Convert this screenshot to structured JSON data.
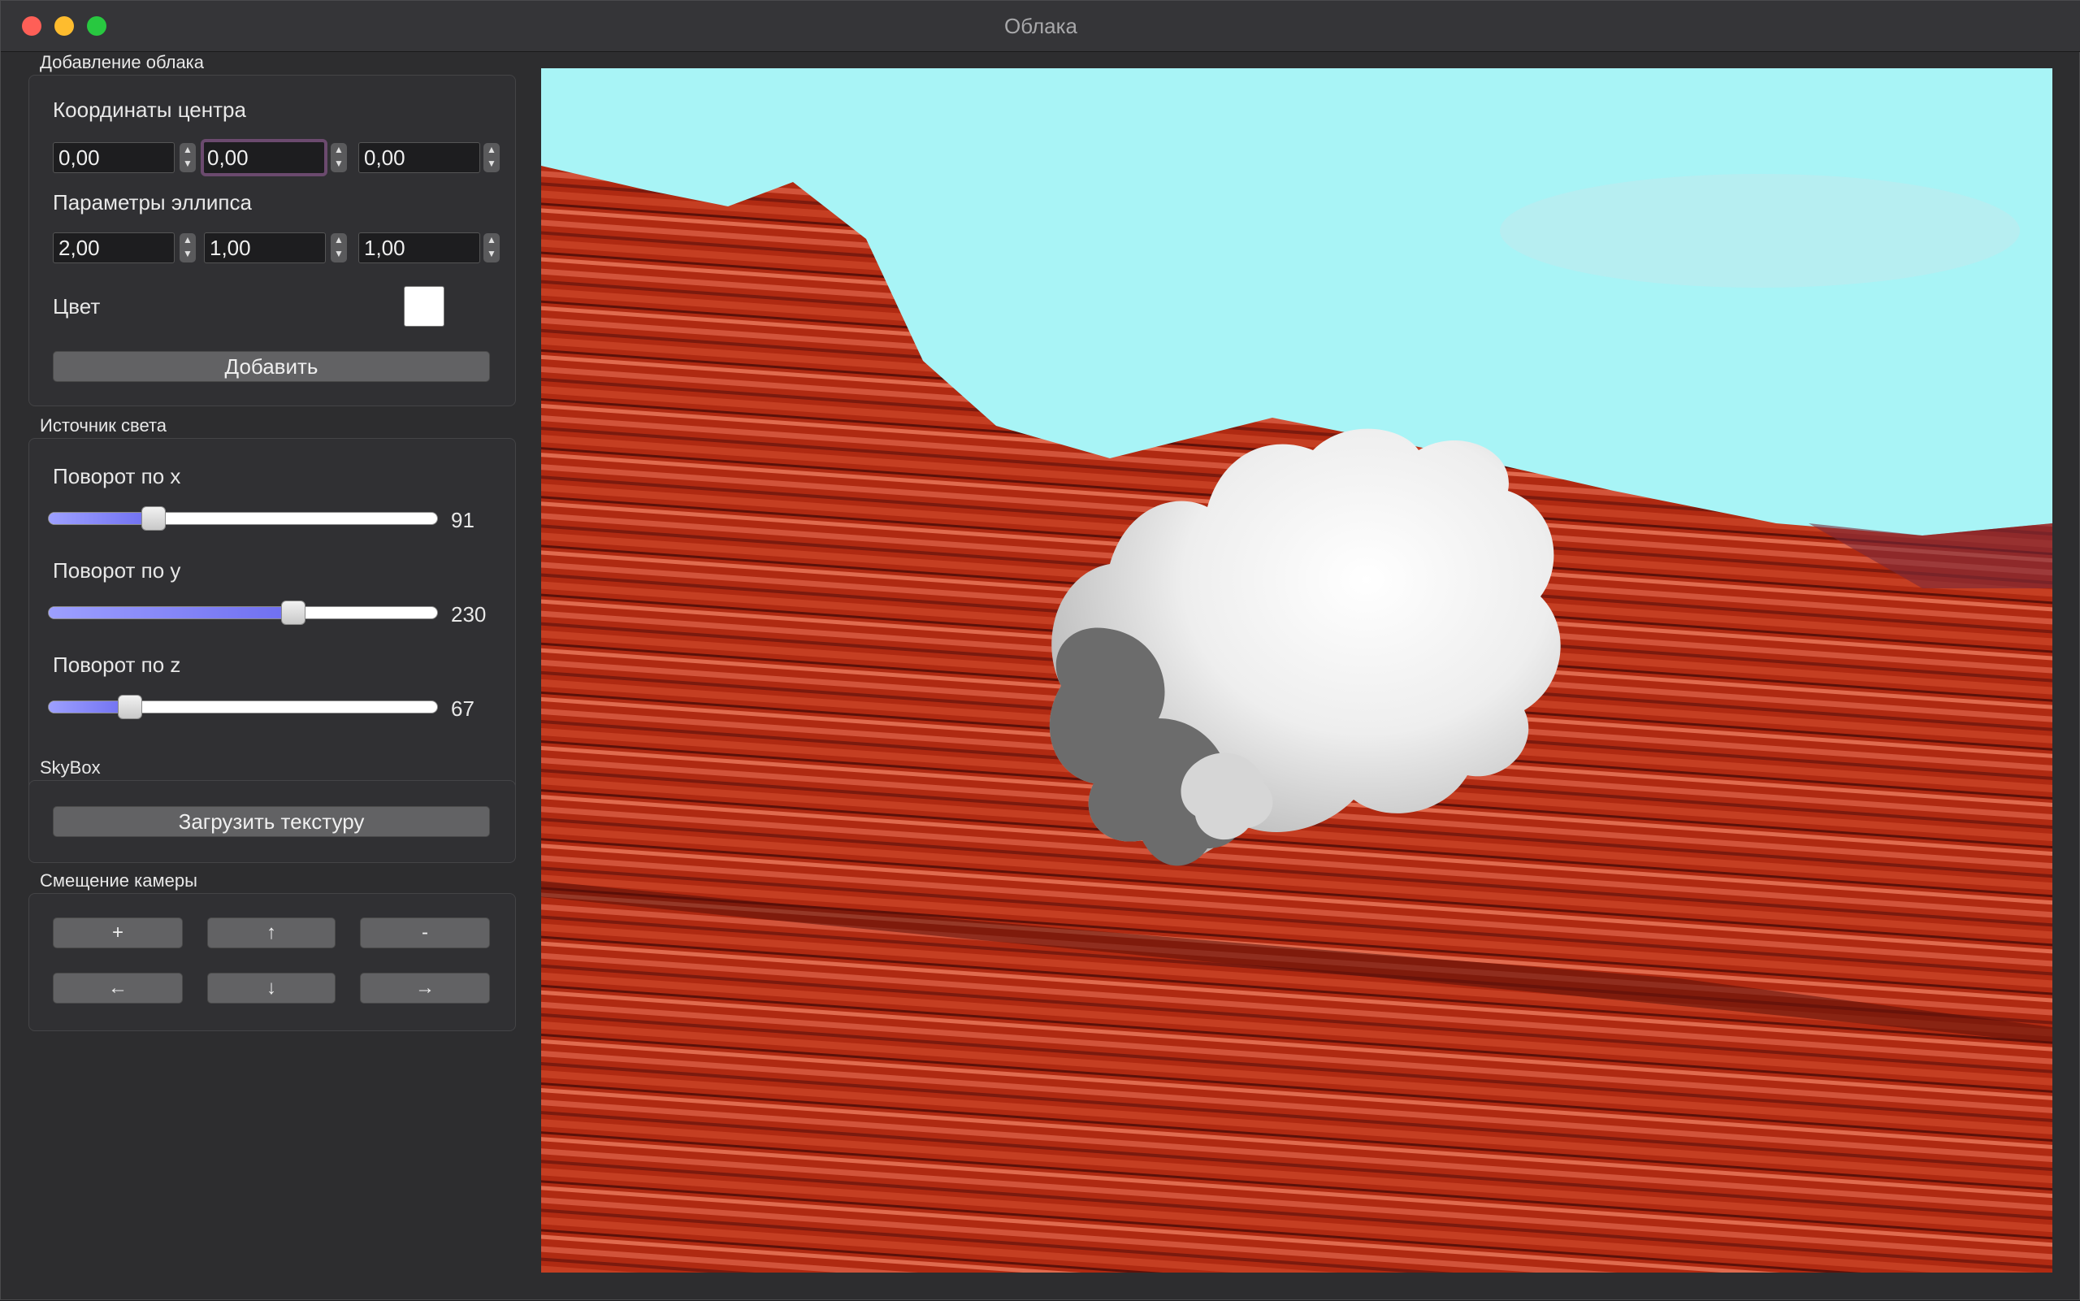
{
  "window": {
    "title": "Облака"
  },
  "cloud_group": {
    "title": "Добавление облака",
    "center_label": "Координаты центра",
    "center": [
      "0,00",
      "0,00",
      "0,00"
    ],
    "ellipse_label": "Параметры эллипса",
    "ellipse": [
      "2,00",
      "1,00",
      "1,00"
    ],
    "color_label": "Цвет",
    "color_value": "#ffffff",
    "add_button": "Добавить"
  },
  "light_group": {
    "title": "Источник света",
    "sliders": [
      {
        "label": "Поворот по x",
        "value": "91",
        "fraction": 0.27
      },
      {
        "label": "Поворот по y",
        "value": "230",
        "fraction": 0.63
      },
      {
        "label": "Поворот по z",
        "value": "67",
        "fraction": 0.21
      }
    ]
  },
  "skybox_group": {
    "title": "SkyBox",
    "load_button": "Загрузить текстуру"
  },
  "camera_group": {
    "title": "Смещение камеры",
    "buttons": {
      "zoom_in": "+",
      "up": "↑",
      "zoom_out": "-",
      "left": "←",
      "down": "↓",
      "right": "→"
    }
  },
  "scene": {
    "sky_color": "#a8f4f6",
    "terrain_color": "#b02a12",
    "cloud_color": "#ffffff"
  }
}
